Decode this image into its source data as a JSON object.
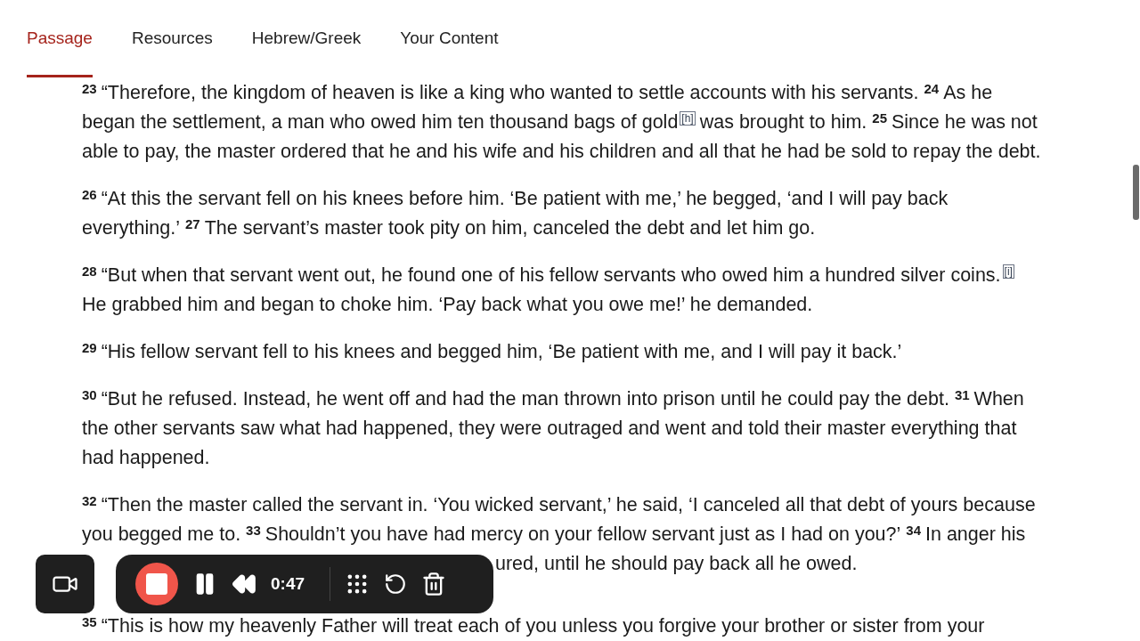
{
  "tabs": [
    {
      "label": "Passage",
      "selected": true
    },
    {
      "label": "Resources",
      "selected": false
    },
    {
      "label": "Hebrew/Greek",
      "selected": false
    },
    {
      "label": "Your Content",
      "selected": false
    }
  ],
  "paragraphs": [
    {
      "lines": [
        {
          "kind": "full",
          "segments": [
            {
              "kind": "verse",
              "text": "23"
            },
            {
              "kind": "text",
              "text": "“Therefore, the kingdom of heaven is like a king who wanted to settle accounts with his servants."
            },
            {
              "kind": "verse",
              "text": "24"
            },
            {
              "kind": "text",
              "text": "As he"
            }
          ]
        },
        {
          "kind": "full",
          "segments": [
            {
              "kind": "text",
              "text": "began the settlement, a man who owed him ten thousand bags of gold"
            },
            {
              "kind": "footnote",
              "text": "[h]"
            },
            {
              "kind": "text",
              "text": "was brought to him."
            },
            {
              "kind": "verse",
              "text": "25"
            },
            {
              "kind": "text",
              "text": "Since he was not"
            }
          ]
        },
        {
          "kind": "full",
          "segments": [
            {
              "kind": "text",
              "text": "able to pay, the master ordered that he and his wife and his children and all that he had be sold to repay the debt."
            }
          ]
        }
      ]
    },
    {
      "lines": [
        {
          "kind": "full",
          "segments": [
            {
              "kind": "verse",
              "text": "26"
            },
            {
              "kind": "text",
              "text": "“At this the servant fell on his knees before him. ‘Be patient with me,’ he begged, ‘and I will pay back"
            }
          ]
        },
        {
          "kind": "full",
          "segments": [
            {
              "kind": "text",
              "text": "everything.’"
            },
            {
              "kind": "verse",
              "text": "27"
            },
            {
              "kind": "text",
              "text": "The servant’s master took pity on him, canceled the debt and let him go."
            }
          ]
        }
      ]
    },
    {
      "lines": [
        {
          "kind": "full",
          "segments": [
            {
              "kind": "verse",
              "text": "28"
            },
            {
              "kind": "text",
              "text": "“But when that servant went out, he found one of his fellow servants who owed him a hundred silver coins."
            },
            {
              "kind": "footnote",
              "text": "[i]"
            }
          ]
        },
        {
          "kind": "full",
          "segments": [
            {
              "kind": "text",
              "text": "He grabbed him and began to choke him. ‘Pay back what you owe me!’ he demanded."
            }
          ]
        }
      ]
    },
    {
      "lines": [
        {
          "kind": "full",
          "segments": [
            {
              "kind": "verse",
              "text": "29"
            },
            {
              "kind": "text",
              "text": "“His fellow servant fell to his knees and begged him, ‘Be patient with me, and I will pay it back.’"
            }
          ]
        }
      ]
    },
    {
      "lines": [
        {
          "kind": "full",
          "segments": [
            {
              "kind": "verse",
              "text": "30"
            },
            {
              "kind": "text",
              "text": "“But he refused. Instead, he went off and had the man thrown into prison until he could pay the debt."
            },
            {
              "kind": "verse",
              "text": "31"
            },
            {
              "kind": "text",
              "text": "When"
            }
          ]
        },
        {
          "kind": "full",
          "segments": [
            {
              "kind": "text",
              "text": "the other servants saw what had happened, they were outraged and went and told their master everything that"
            }
          ]
        },
        {
          "kind": "full",
          "segments": [
            {
              "kind": "text",
              "text": "had happened."
            }
          ]
        }
      ]
    },
    {
      "lines": [
        {
          "kind": "full",
          "segments": [
            {
              "kind": "verse",
              "text": "32"
            },
            {
              "kind": "text",
              "text": "“Then the master called the servant in. ‘You wicked servant,’ he said, ‘I canceled all that debt of yours because"
            }
          ]
        },
        {
          "kind": "full",
          "segments": [
            {
              "kind": "text",
              "text": "you begged me to."
            },
            {
              "kind": "verse",
              "text": "33"
            },
            {
              "kind": "text",
              "text": "Shouldn’t you have had mercy on your fellow servant just as I had on you?’"
            },
            {
              "kind": "verse",
              "text": "34"
            },
            {
              "kind": "text",
              "text": "In anger his"
            }
          ]
        },
        {
          "kind": "after-toolbar",
          "segments": [
            {
              "kind": "text",
              "text": "ured, until he should pay back all he owed."
            }
          ]
        }
      ]
    },
    {
      "lines": [
        {
          "kind": "full",
          "segments": [
            {
              "kind": "verse",
              "text": "35"
            },
            {
              "kind": "text",
              "text": "“This is how my heavenly Father will treat each of you unless you forgive your brother or sister from your"
            }
          ]
        }
      ]
    }
  ],
  "recorder": {
    "time": "0:47"
  }
}
